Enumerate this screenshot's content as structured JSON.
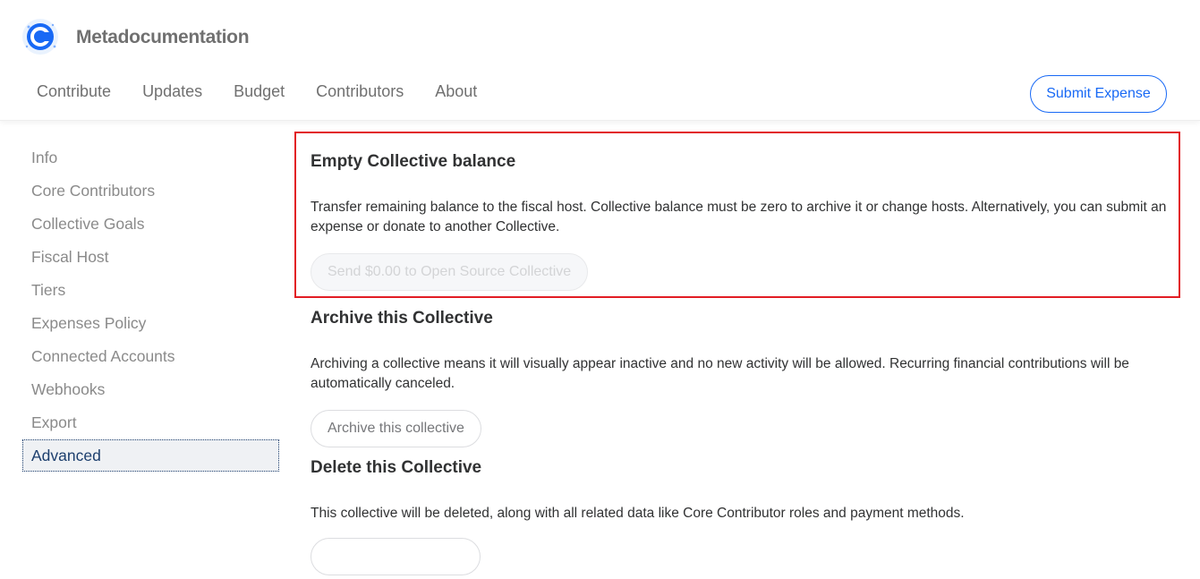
{
  "header": {
    "title": "Metadocumentation",
    "logo_icon": "open-collective-logo-icon",
    "nav": [
      "Contribute",
      "Updates",
      "Budget",
      "Contributors",
      "About"
    ],
    "submit_label": "Submit Expense",
    "accent": "#1869f5"
  },
  "sidebar": {
    "items": [
      {
        "label": "Info"
      },
      {
        "label": "Core Contributors"
      },
      {
        "label": "Collective Goals"
      },
      {
        "label": "Fiscal Host"
      },
      {
        "label": "Tiers"
      },
      {
        "label": "Expenses Policy"
      },
      {
        "label": "Connected Accounts"
      },
      {
        "label": "Webhooks"
      },
      {
        "label": "Export"
      },
      {
        "label": "Advanced"
      }
    ],
    "active": "Advanced"
  },
  "main": {
    "empty_balance": {
      "title": "Empty Collective balance",
      "text_line1": "Transfer remaining balance to the fiscal host. Collective balance must be zero to archive it or change hosts. Alternatively, you can submit an",
      "text_line2": "expense or donate to another Collective.",
      "button": "Send $0.00 to Open Source Collective",
      "highlight_color": "#e21d24"
    },
    "archive": {
      "title": "Archive this Collective",
      "text_line1": "Archiving a collective means it will visually appear inactive and no new activity will be allowed. Recurring financial contributions will be",
      "text_line2": "automatically canceled.",
      "button": "Archive this collective"
    },
    "delete": {
      "title": "Delete this Collective",
      "text": "This collective will be deleted, along with all related data like Core Contributor roles and payment methods."
    }
  }
}
